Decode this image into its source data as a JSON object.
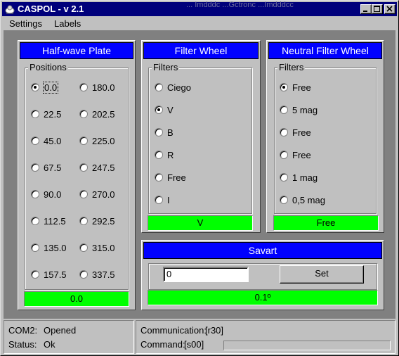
{
  "window": {
    "title": "CASPOL - v 2.1",
    "ghost_text": "... Imdddc    ...Gctronc    ...Imdddcc"
  },
  "menu": {
    "settings": "Settings",
    "labels": "Labels"
  },
  "halfwave": {
    "title": "Half-wave Plate",
    "group_label": "Positions",
    "options": [
      "0.0",
      "180.0",
      "22.5",
      "202.5",
      "45.0",
      "225.0",
      "67.5",
      "247.5",
      "90.0",
      "270.0",
      "112.5",
      "292.5",
      "135.0",
      "315.0",
      "157.5",
      "337.5"
    ],
    "selected": "0.0",
    "status": "0.0"
  },
  "filter_wheel": {
    "title": "Filter Wheel",
    "group_label": "Filters",
    "options": [
      "Ciego",
      "V",
      "B",
      "R",
      "Free",
      "I"
    ],
    "selected": "V",
    "status": "V"
  },
  "neutral_filter": {
    "title": "Neutral Filter Wheel",
    "group_label": "Filters",
    "options": [
      "Free",
      "5 mag",
      "Free",
      "Free",
      "1 mag",
      "0,5 mag"
    ],
    "selected_index": 0,
    "status": "Free"
  },
  "savart": {
    "title": "Savart",
    "input_value": "0",
    "set_label": "Set",
    "status": "0.1º"
  },
  "statusbar": {
    "com_label": "COM2:",
    "com_value": "Opened",
    "status_label": "Status:",
    "status_value": "Ok",
    "communication_label": "Communication:",
    "communication_value": "[r30]",
    "command_label": "Command:",
    "command_value": "[s00]",
    "progress": 0
  },
  "colors": {
    "header_blue": "#0000ff",
    "status_green": "#00ff00",
    "titlebar": "#00007b"
  }
}
